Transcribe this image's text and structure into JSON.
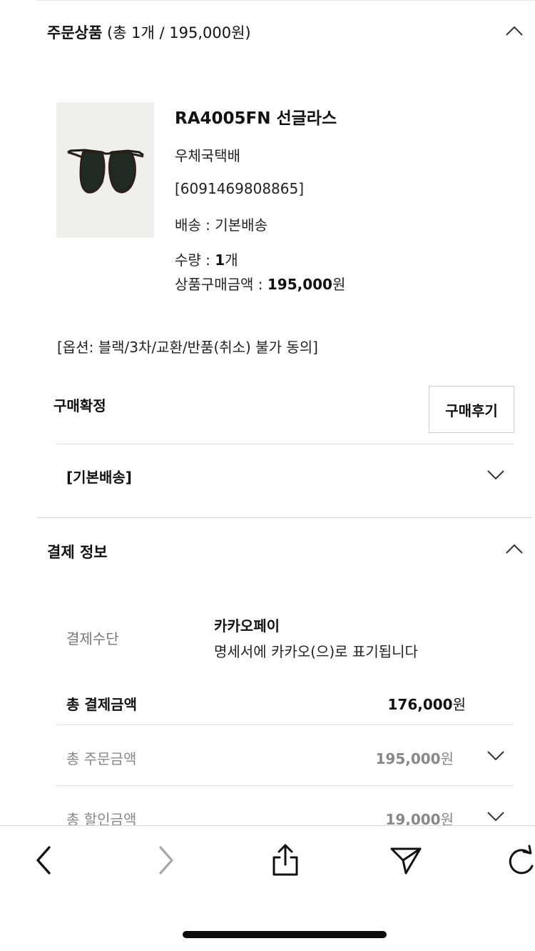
{
  "order_section": {
    "title": "주문상품",
    "summary": "(총 1개 / 195,000원)"
  },
  "product": {
    "name": "RA4005FN 선글라스",
    "courier": "우체국택배",
    "tracking": "[6091469808865]",
    "shipping_label": "배송 : ",
    "shipping_value": "기본배송",
    "qty_label": "수량 : ",
    "qty_value": "1",
    "qty_unit": "개",
    "price_label": "상품구매금액 : ",
    "price_value": "195,000",
    "price_unit": "원",
    "option": "[옵션: 블랙/3차/교환/반품(취소) 불가 동의]"
  },
  "status": {
    "confirm_label": "구매확정",
    "review_button": "구매후기"
  },
  "shipping_group": {
    "label": "[기본배송]"
  },
  "payment_section": {
    "title": "결제 정보",
    "method_label": "결제수단",
    "method_value": "카카오페이",
    "method_note": "명세서에 카카오(으)로 표기됩니다",
    "total_label": "총 결제금액",
    "total_value": "176,000",
    "total_unit": "원",
    "order_total_label": "총 주문금액",
    "order_total_value": "195,000",
    "order_total_unit": "원",
    "discount_label": "총 할인금액",
    "discount_value": "19,000",
    "discount_unit": "원"
  },
  "browser_bar": {
    "icons": [
      "back-icon",
      "forward-icon",
      "share-icon",
      "send-icon",
      "reload-icon"
    ]
  }
}
